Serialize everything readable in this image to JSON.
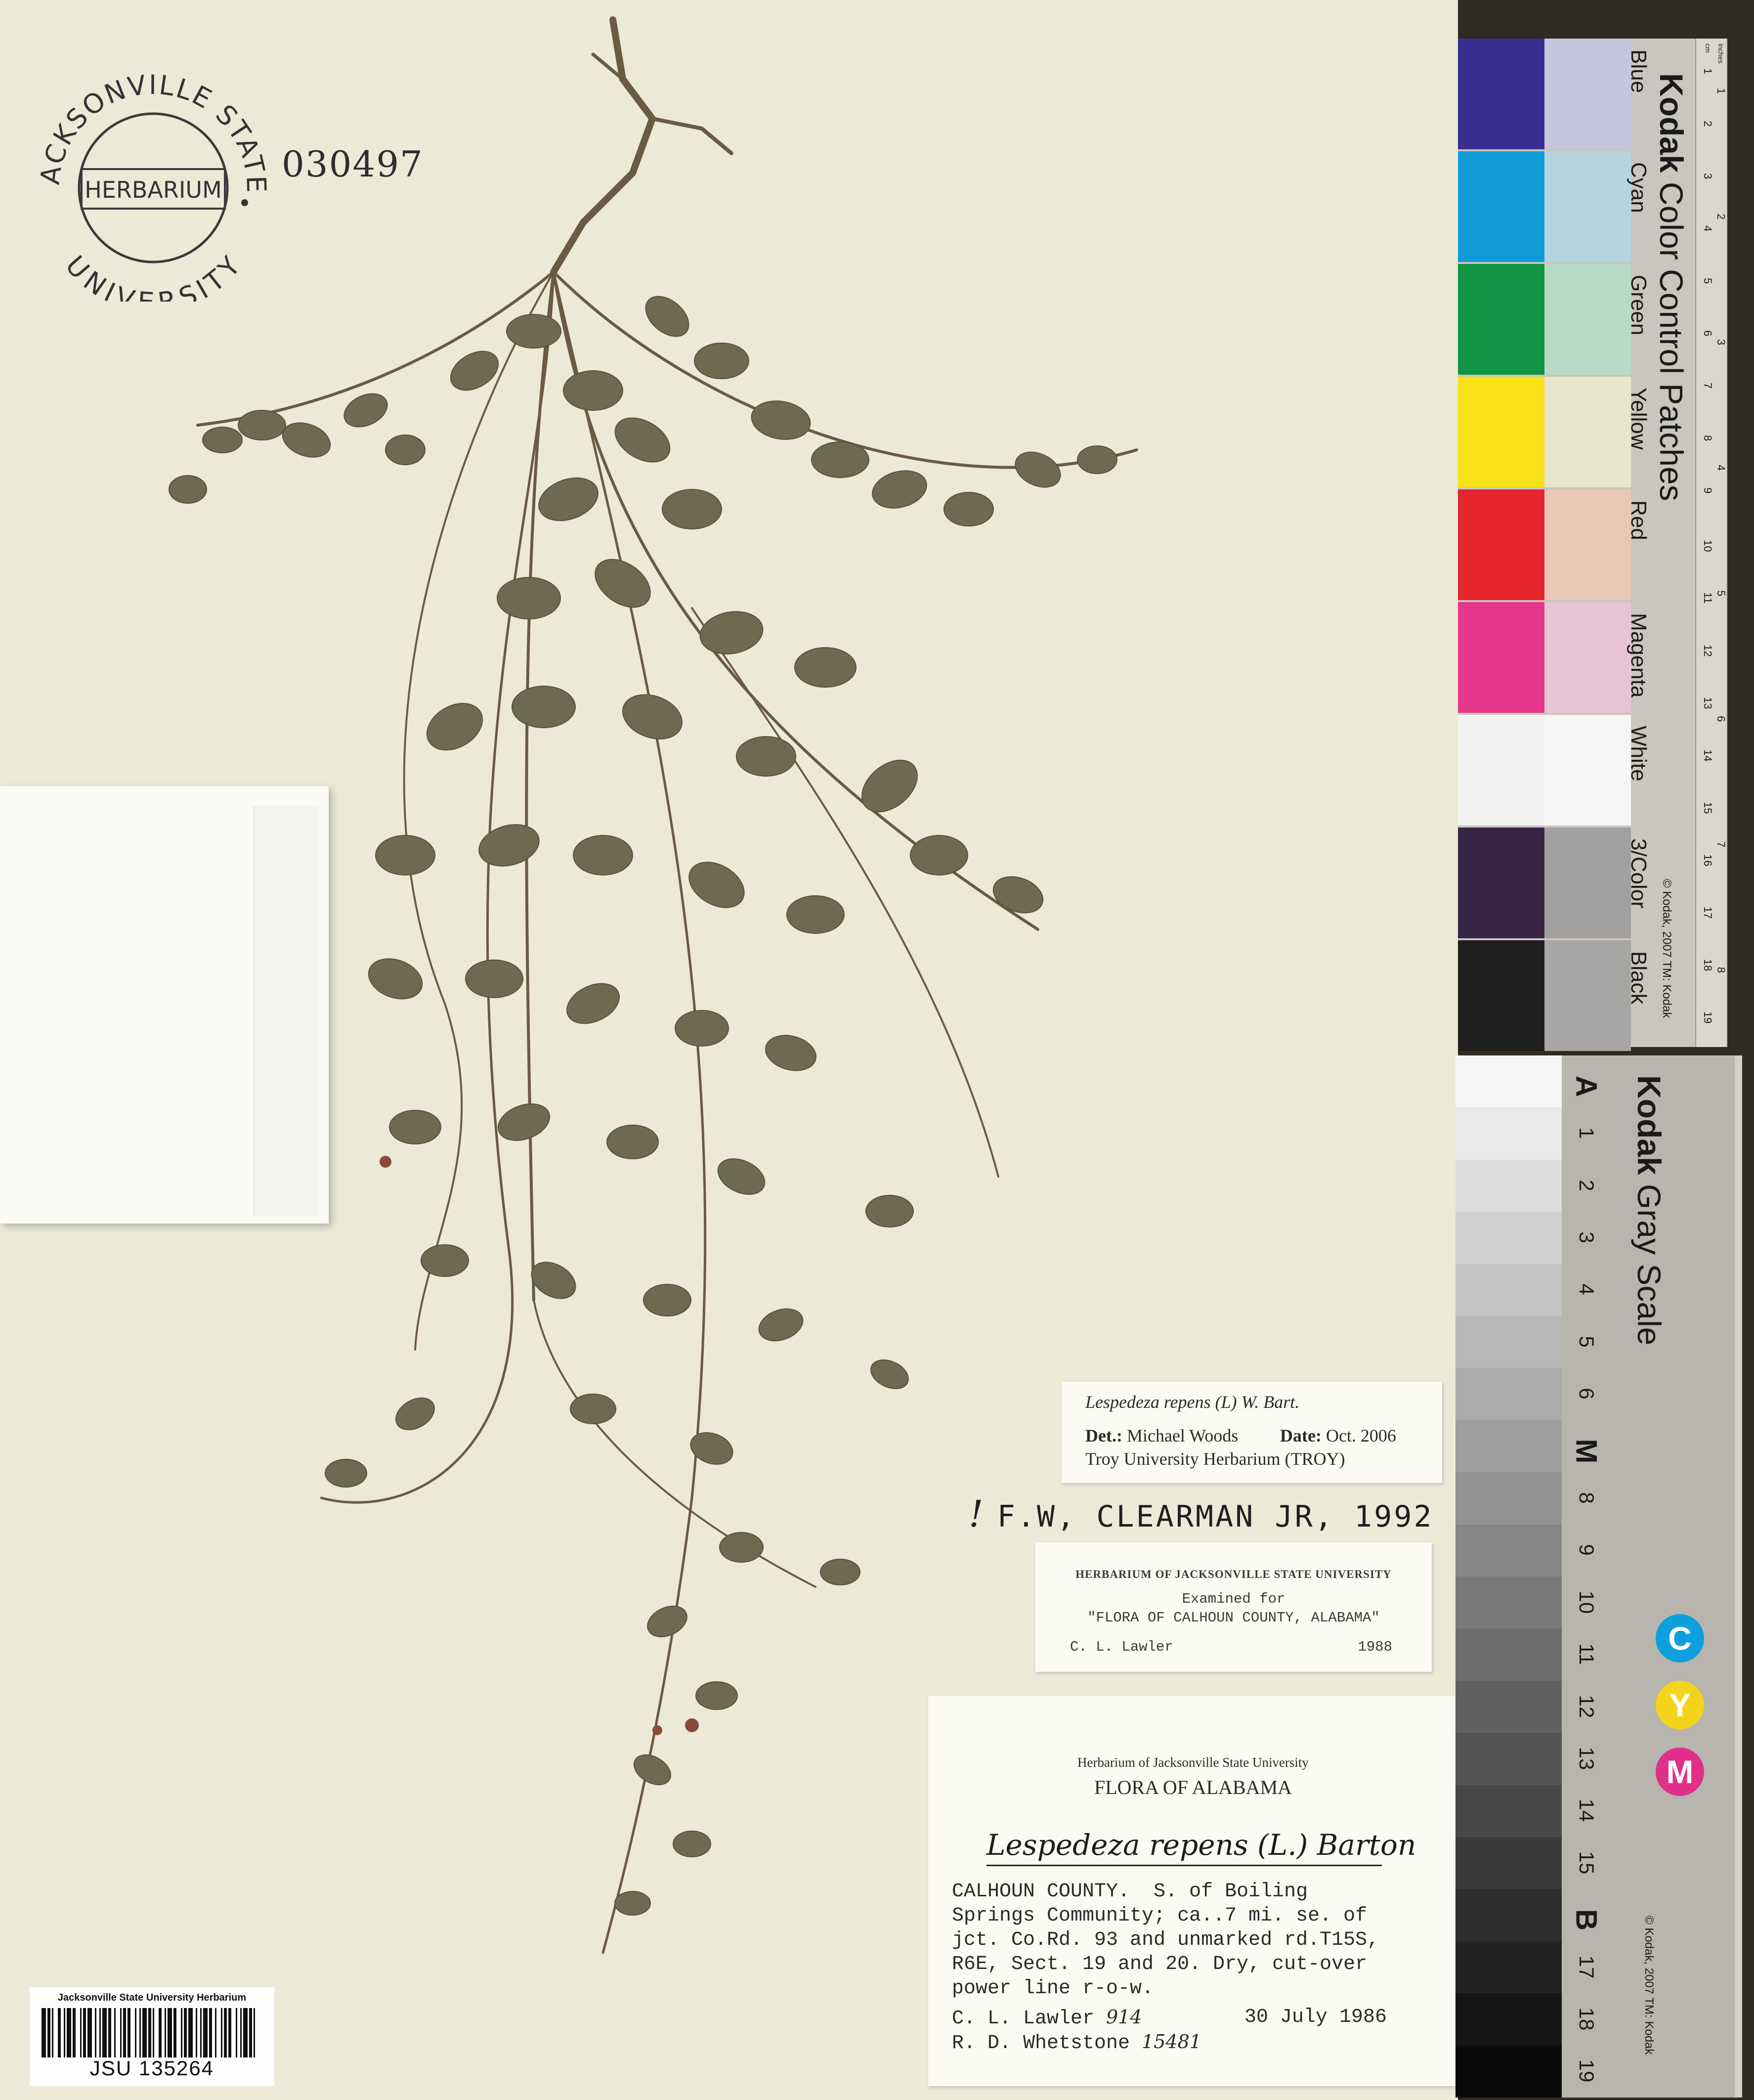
{
  "stamp": {
    "top_text": "JACKSONVILLE STATE",
    "center_text": "HERBARIUM",
    "bottom_text": "UNIVERSITY"
  },
  "accession_number": "030497",
  "determination": {
    "taxon": "Lespedeza repens (L) W. Bart.",
    "det_label": "Det.:",
    "det_name": "Michael Woods",
    "date_label": "Date:",
    "date_value": "Oct. 2006",
    "institution": "Troy University Herbarium (TROY)"
  },
  "annotation": {
    "mark": "!",
    "text": "F.W, CLEARMAN JR, 1992"
  },
  "examined_label": {
    "title": "HERBARIUM OF JACKSONVILLE STATE UNIVERSITY",
    "line2": "Examined for",
    "line3": "\"FLORA OF CALHOUN COUNTY, ALABAMA\"",
    "examiner": "C. L. Lawler",
    "year": "1988"
  },
  "main_label": {
    "institution": "Herbarium of Jacksonville State University",
    "flora": "FLORA OF ALABAMA",
    "taxon_handwritten": "Lespedeza repens (L.) Barton",
    "locality": "CALHOUN COUNTY.  S. of Boiling\nSprings Community; ca..7 mi. se. of\njct. Co.Rd. 93 and unmarked rd.T15S,\nR6E, Sect. 19 and 20. Dry, cut-over\npower line r-o-w.",
    "collector1": "C. L. Lawler",
    "collector1_number": "914",
    "collector2": "R. D. Whetstone",
    "collector2_number": "15481",
    "collection_date": "30 July 1986"
  },
  "barcode_label": {
    "title": "Jacksonville State University Herbarium",
    "number": "JSU 135264"
  },
  "color_card": {
    "brand": "Kodak",
    "title": "Color Control Patches",
    "copyright": "© Kodak, 2007 TM: Kodak",
    "patches": [
      {
        "name": "Blue",
        "color": "#3a2f8f",
        "tint": "#c3c6dc"
      },
      {
        "name": "Cyan",
        "color": "#0e9bd8",
        "tint": "#b4d5e0"
      },
      {
        "name": "Green",
        "color": "#119444",
        "tint": "#b8dbc8"
      },
      {
        "name": "Yellow",
        "color": "#f7e117",
        "tint": "#e7e6cc"
      },
      {
        "name": "Red",
        "color": "#e5262e",
        "tint": "#e9c6b6"
      },
      {
        "name": "Magenta",
        "color": "#e5388c",
        "tint": "#e6c4d4"
      },
      {
        "name": "White",
        "color": "#f2f2f2",
        "tint": "#f6f6f6"
      },
      {
        "name": "3/Color",
        "color": "#3b2546",
        "tint": "#a2a09f"
      },
      {
        "name": "Black",
        "color": "#1f1f1f",
        "tint": "#a7a6a4"
      }
    ],
    "ruler_numbers": [
      "1",
      "2",
      "3",
      "4",
      "5",
      "6",
      "7",
      "8",
      "9",
      "10",
      "11",
      "12",
      "13",
      "14",
      "15",
      "16",
      "17",
      "18",
      "19"
    ],
    "ruler_inch_numbers": [
      "1",
      "2",
      "3",
      "4",
      "5",
      "6",
      "7",
      "8"
    ],
    "ruler_units": [
      "inches",
      "cm"
    ]
  },
  "gray_card": {
    "brand": "Kodak",
    "title": "Gray Scale",
    "copyright": "© Kodak, 2007 TM: Kodak",
    "steps": [
      "A",
      "1",
      "2",
      "3",
      "4",
      "5",
      "6",
      "M",
      "8",
      "9",
      "10",
      "11",
      "12",
      "13",
      "14",
      "15",
      "B",
      "17",
      "18",
      "19"
    ],
    "cym": [
      {
        "letter": "C",
        "color": "#0ea0dc"
      },
      {
        "letter": "Y",
        "color": "#f2d51b"
      },
      {
        "letter": "M",
        "color": "#e0308a"
      }
    ]
  },
  "colors": {
    "paper": "#ecead7",
    "leaf": "#6e6a52",
    "stem": "#6b5a44"
  }
}
